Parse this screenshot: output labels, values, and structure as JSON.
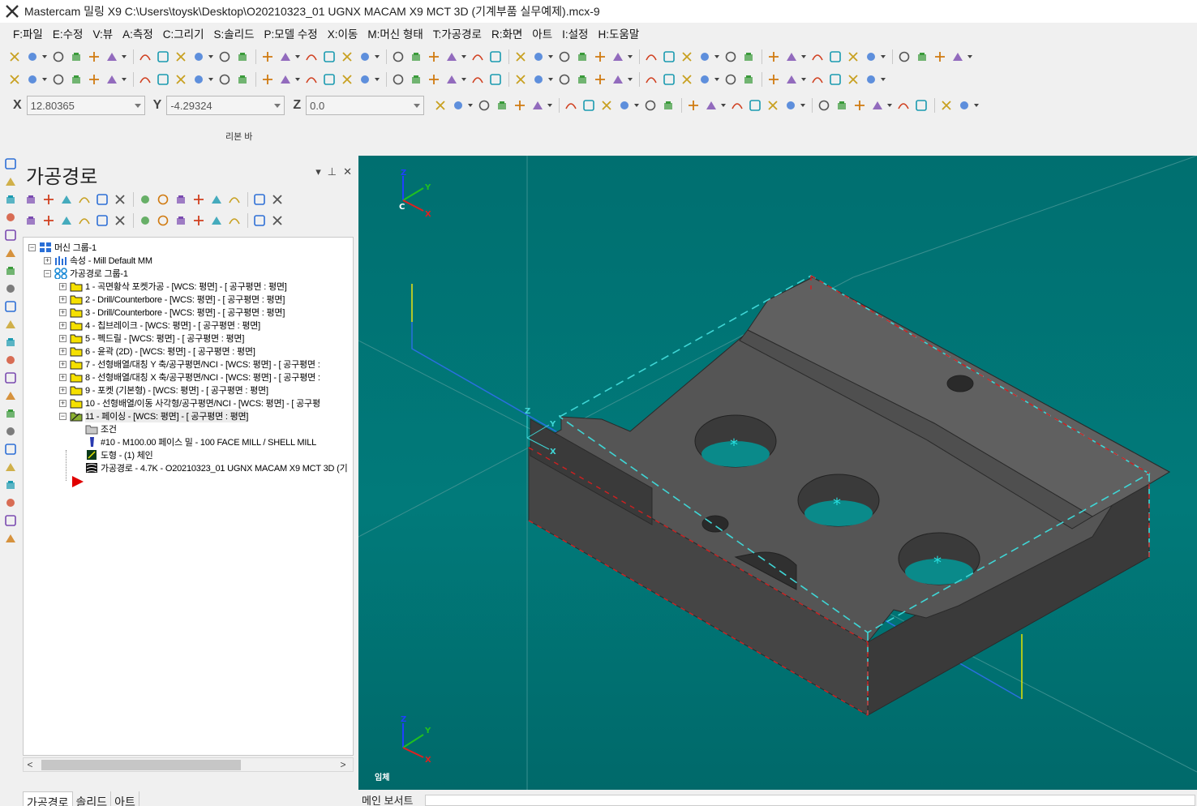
{
  "window": {
    "title": "Mastercam 밀링 X9  C:\\Users\\toysk\\Desktop\\O20210323_01 UGNX MACAM X9 MCT 3D (기계부품 실무예제).mcx-9"
  },
  "menu": [
    "F:파일",
    "E:수정",
    "V:뷰",
    "A:측정",
    "C:그리기",
    "S:솔리드",
    "P:모델 수정",
    "X:이동",
    "M:머신 형태",
    "T:가공경로",
    "R:화면",
    "아트",
    "I:설정",
    "H:도움말"
  ],
  "coords": {
    "x_label": "X",
    "x_value": "12.80365",
    "y_label": "Y",
    "y_value": "-4.29324",
    "z_label": "Z",
    "z_value": "0.0"
  },
  "ribbon_label": "리본 바",
  "panel": {
    "title": "가공경로",
    "pin": "ᵖ",
    "close": "✕"
  },
  "tree": [
    {
      "level": 0,
      "exp": "−",
      "icon": "machine-group-icon",
      "label": "머신 그룹-1"
    },
    {
      "level": 1,
      "exp": "+",
      "icon": "properties-icon",
      "label": "속성 - Mill Default MM"
    },
    {
      "level": 1,
      "exp": "−",
      "icon": "toolpath-group-icon",
      "label": "가공경로 그룹-1"
    },
    {
      "level": 2,
      "exp": "+",
      "icon": "folder-icon",
      "label": "1 - 곡면황삭 포켓가공 - [WCS: 평면] - [ 공구평면 : 평면]"
    },
    {
      "level": 2,
      "exp": "+",
      "icon": "folder-icon",
      "label": "2 - Drill/Counterbore - [WCS: 평면] - [ 공구평면 : 평면]"
    },
    {
      "level": 2,
      "exp": "+",
      "icon": "folder-icon",
      "label": "3 - Drill/Counterbore - [WCS: 평면] - [ 공구평면 : 평면]"
    },
    {
      "level": 2,
      "exp": "+",
      "icon": "folder-icon",
      "label": "4 - 칩브레이크 - [WCS: 평면] - [ 공구평면 : 평면]"
    },
    {
      "level": 2,
      "exp": "+",
      "icon": "folder-icon",
      "label": "5 - 펙드릴 - [WCS: 평면] - [ 공구평면 : 평면]"
    },
    {
      "level": 2,
      "exp": "+",
      "icon": "folder-icon",
      "label": "6 - 윤곽 (2D) - [WCS: 평면] - [ 공구평면 : 평면]"
    },
    {
      "level": 2,
      "exp": "+",
      "icon": "folder-icon",
      "label": "7 - 선형배열/대칭 Y 축/공구평면/NCI - [WCS: 평면] - [ 공구평면 :"
    },
    {
      "level": 2,
      "exp": "+",
      "icon": "folder-icon",
      "label": "8 - 선형배열/대칭 X 축/공구평면/NCI - [WCS: 평면] - [ 공구평면 :"
    },
    {
      "level": 2,
      "exp": "+",
      "icon": "folder-icon",
      "label": "9 - 포켓 (기본형) - [WCS: 평면] - [ 공구평면 : 평면]"
    },
    {
      "level": 2,
      "exp": "+",
      "icon": "folder-icon",
      "label": "10 - 선형배열/이동 사각형/공구평면/NCI - [WCS: 평면] - [ 공구평"
    },
    {
      "level": 2,
      "exp": "−",
      "icon": "open-folder-icon",
      "label": "11 - 페이싱 - [WCS: 평면] - [ 공구평면 : 평면]",
      "selected": true
    },
    {
      "level": 3,
      "exp": "",
      "icon": "parameters-icon",
      "label": "조건"
    },
    {
      "level": 3,
      "exp": "",
      "icon": "tool-icon",
      "label": "#10 - M100.00 페이스 밀 - 100 FACE MILL / SHELL MILL"
    },
    {
      "level": 3,
      "exp": "",
      "icon": "geometry-icon",
      "label": "도형 - (1) 체인"
    },
    {
      "level": 3,
      "exp": "",
      "icon": "toolpath-icon",
      "label": "가공경로 - 4.7K - O20210323_01 UGNX MACAM X9 MCT 3D (기"
    }
  ],
  "panel_tabs": [
    "가공경로",
    "솔리드",
    "아트"
  ],
  "viewport": {
    "view_label": "임체",
    "axis_x": "X",
    "axis_y": "Y",
    "axis_z": "Z",
    "axis_c": "C"
  },
  "bottom_tabs": [
    "메인 보서트"
  ],
  "colors": {
    "viewport_bg": "#017777",
    "part_gray": "#4a4a4a",
    "cyan_dash": "#3fd6d6",
    "red_dash": "#d02020",
    "toolpath_blue": "#2a6fe0"
  }
}
